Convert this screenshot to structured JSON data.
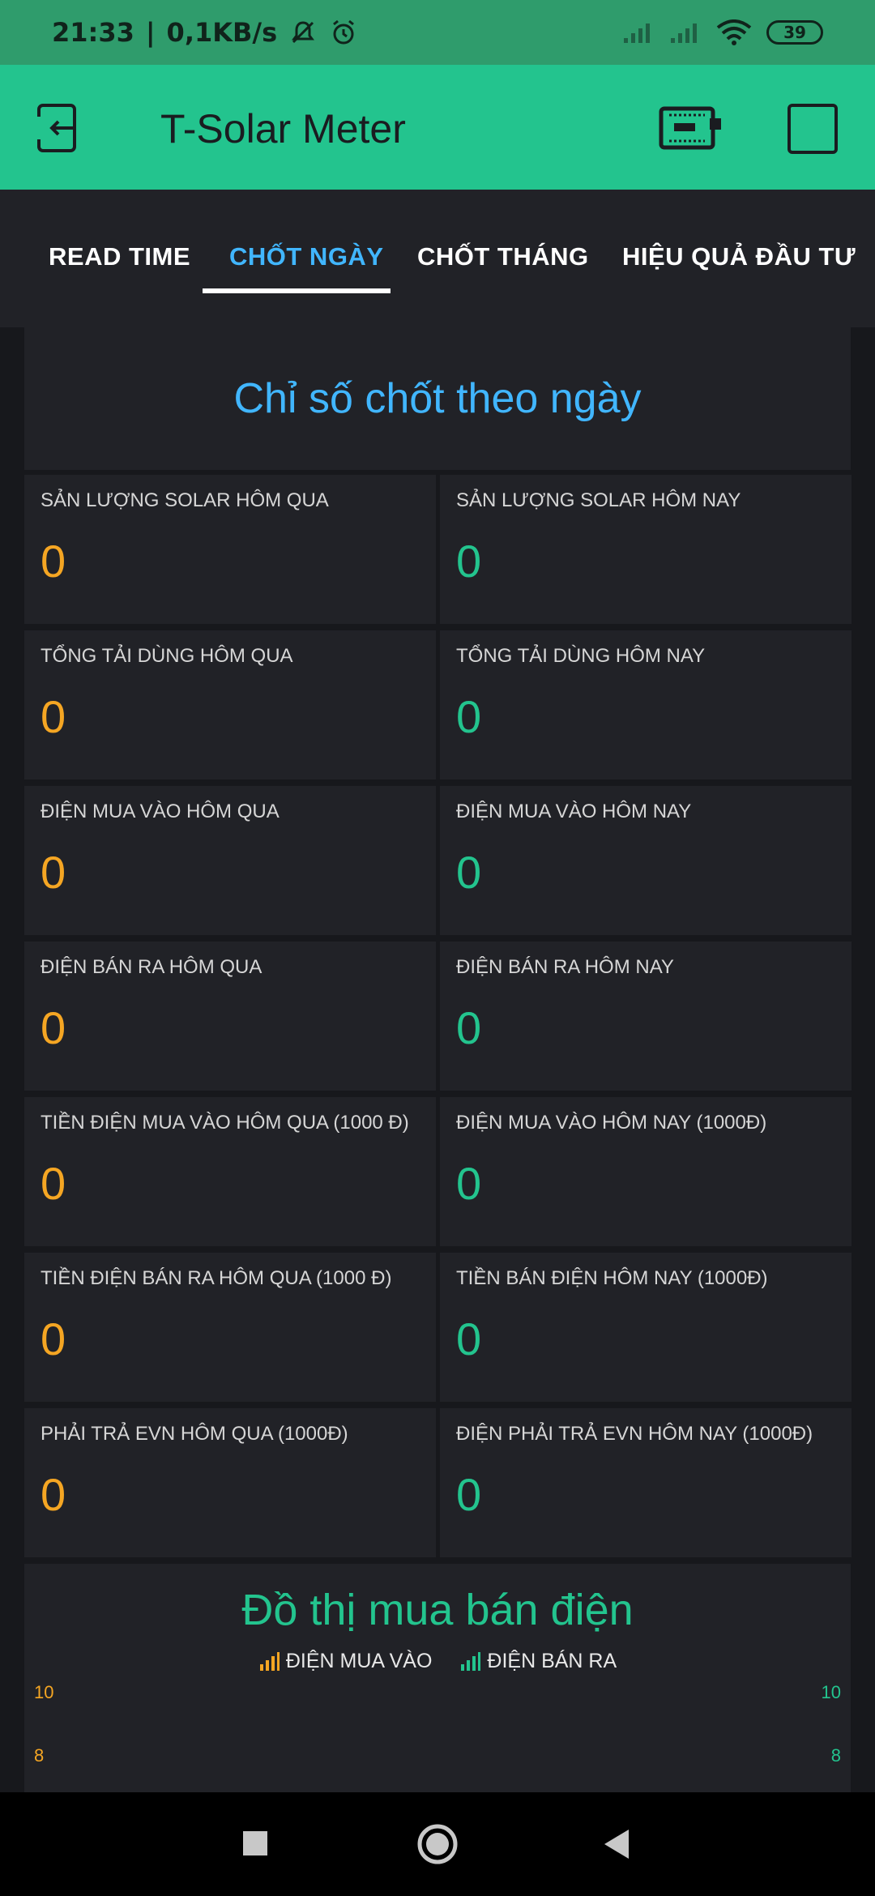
{
  "status": {
    "time": "21:33",
    "speed": "0,1KB/s",
    "battery": "39"
  },
  "app": {
    "title": "T-Solar Meter"
  },
  "tabs": [
    {
      "label": "READ TIME"
    },
    {
      "label": "CHỐT NGÀY"
    },
    {
      "label": "CHỐT THÁNG"
    },
    {
      "label": "HIỆU QUẢ ĐẦU TƯ"
    }
  ],
  "header": {
    "title": "Chỉ số chốt theo ngày"
  },
  "cells": [
    {
      "label": "SẢN LƯỢNG SOLAR HÔM QUA",
      "value": "0"
    },
    {
      "label": "SẢN LƯỢNG SOLAR HÔM NAY",
      "value": "0"
    },
    {
      "label": "TỔNG TẢI DÙNG HÔM QUA",
      "value": "0"
    },
    {
      "label": "TỔNG TẢI DÙNG HÔM NAY",
      "value": "0"
    },
    {
      "label": "ĐIỆN MUA VÀO HÔM QUA",
      "value": "0"
    },
    {
      "label": "ĐIỆN MUA VÀO HÔM NAY",
      "value": "0"
    },
    {
      "label": "ĐIỆN BÁN RA HÔM QUA",
      "value": "0"
    },
    {
      "label": "ĐIỆN BÁN RA HÔM NAY",
      "value": "0"
    },
    {
      "label": "TIỀN ĐIỆN MUA VÀO HÔM QUA (1000 Đ)",
      "value": "0"
    },
    {
      "label": "ĐIỆN MUA VÀO HÔM NAY (1000Đ)",
      "value": "0"
    },
    {
      "label": "TIỀN ĐIỆN BÁN RA HÔM QUA (1000 Đ)",
      "value": "0"
    },
    {
      "label": "TIỀN BÁN ĐIỆN HÔM NAY (1000Đ)",
      "value": "0"
    },
    {
      "label": "PHẢI TRẢ EVN HÔM QUA (1000Đ)",
      "value": "0"
    },
    {
      "label": "ĐIỆN PHẢI TRẢ EVN HÔM NAY (1000Đ)",
      "value": "0"
    }
  ],
  "chart": {
    "title": "Đồ thị mua bán điện",
    "legend": [
      {
        "name": "ĐIỆN MUA VÀO",
        "color": "#f5a623"
      },
      {
        "name": "ĐIỆN BÁN RA",
        "color": "#23c48e"
      }
    ],
    "left_ticks": [
      "10",
      "8"
    ],
    "right_ticks": [
      "10",
      "8"
    ]
  },
  "colors": {
    "accent": "#23c48e",
    "blue": "#41b6ff",
    "orange": "#f5a623"
  }
}
